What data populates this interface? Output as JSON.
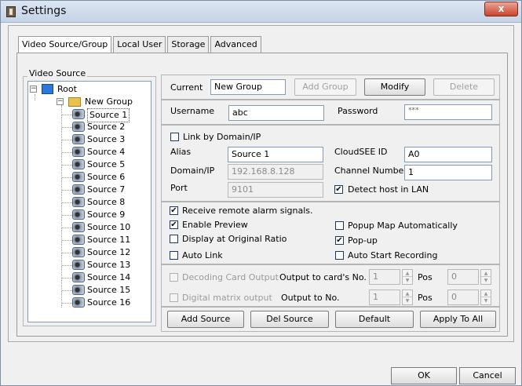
{
  "window": {
    "title": "Settings",
    "close_symbol": "x"
  },
  "tabs": [
    "Video Source/Group",
    "Local User",
    "Storage",
    "Advanced"
  ],
  "video_source": {
    "group_label": "Video Source",
    "tree": {
      "root": "Root",
      "group": "New Group",
      "sources": [
        "Source 1",
        "Source 2",
        "Source 3",
        "Source 4",
        "Source 5",
        "Source 6",
        "Source 7",
        "Source 8",
        "Source 9",
        "Source 10",
        "Source 11",
        "Source 12",
        "Source 13",
        "Source 14",
        "Source 15",
        "Source 16"
      ],
      "selected": "Source 1"
    }
  },
  "group_bar": {
    "current_label": "Current",
    "current_value": "New Group",
    "add_group": "Add Group",
    "modify": "Modify",
    "delete": "Delete"
  },
  "credentials": {
    "username_label": "Username",
    "username_value": "abc",
    "password_label": "Password",
    "password_value": "***"
  },
  "connection": {
    "link_by_domain_label": "Link by Domain/IP",
    "link_by_domain_checked": false,
    "alias_label": "Alias",
    "alias_value": "Source  1",
    "cloudsee_label": "CloudSEE ID",
    "cloudsee_value": "A0",
    "domain_label": "Domain/IP",
    "domain_value": "192.168.8.128",
    "channel_label": "Channel Number",
    "channel_value": "1",
    "port_label": "Port",
    "port_value": "9101",
    "detect_host_label": "Detect host in LAN",
    "detect_host_checked": true
  },
  "options": {
    "receive_alarm_label": "Receive remote alarm signals.",
    "receive_alarm_checked": true,
    "enable_preview_label": "Enable Preview",
    "enable_preview_checked": true,
    "popup_map_label": "Popup Map Automatically",
    "popup_map_checked": false,
    "original_ratio_label": "Display at Original Ratio",
    "original_ratio_checked": false,
    "popup_label": "Pop-up",
    "popup_checked": true,
    "auto_link_label": "Auto Link",
    "auto_link_checked": false,
    "auto_record_label": "Auto Start Recording",
    "auto_record_checked": false
  },
  "output": {
    "decoding_label": "Decoding Card Output",
    "output_card_label": "Output to card's No.",
    "output_card_value": "1",
    "pos_label": "Pos",
    "pos_value_1": "0",
    "matrix_label": "Digital matrix output",
    "output_no_label": "Output to No.",
    "output_no_value": "1",
    "pos_value_2": "0"
  },
  "actions": {
    "add_source": "Add Source",
    "del_source": "Del Source",
    "default": "Default",
    "apply_all": "Apply To All"
  },
  "dialog": {
    "ok": "OK",
    "cancel": "Cancel"
  },
  "check_mark": "✔"
}
